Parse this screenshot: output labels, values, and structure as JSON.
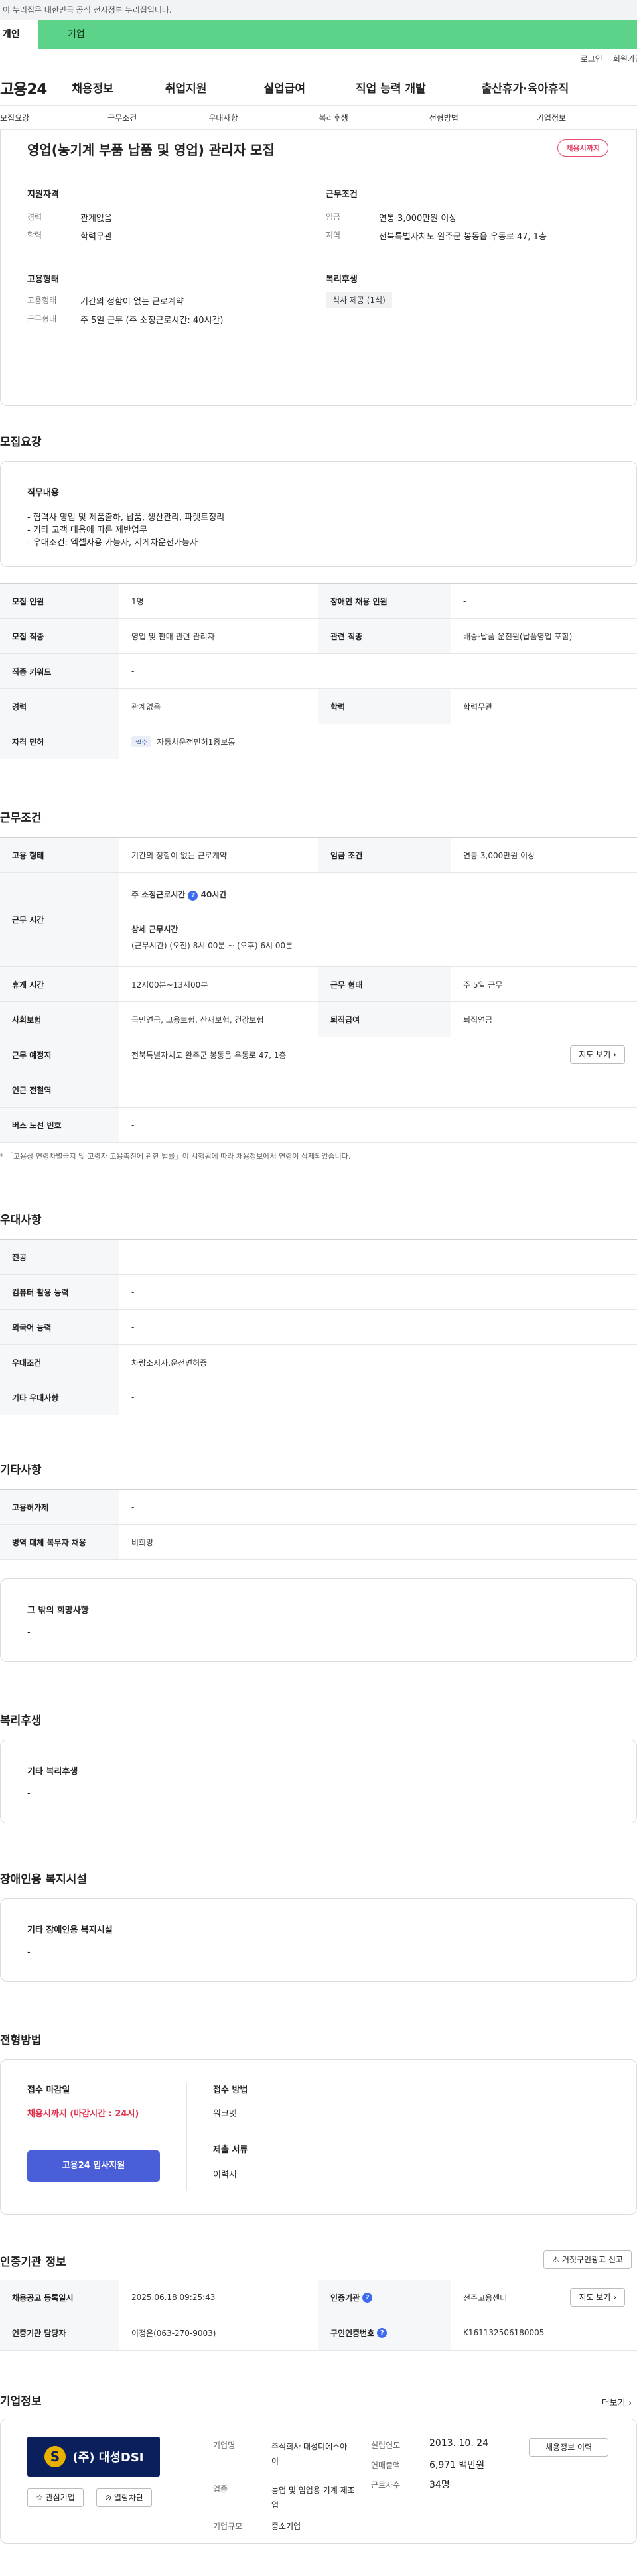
{
  "gov_banner": "이 누리집은 대한민국 공식 전자정부 누리집입니다.",
  "top_tabs": [
    "개인",
    "기업"
  ],
  "util": [
    "로그인",
    "회원가입"
  ],
  "logo": "고용24",
  "gnb": [
    "채용정보",
    "취업지원",
    "실업급여",
    "직업 능력 개발",
    "출산휴가·육아휴직"
  ],
  "subnav": [
    "모집요강",
    "근무조건",
    "우대사항",
    "복리후생",
    "전형방법",
    "기업정보"
  ],
  "job": {
    "title": "영업(농기계 부품 납품 및 영업) 관리자 모집",
    "status": "채용시까지",
    "req_head": "지원자격",
    "career_l": "경력",
    "career_v": "관계없음",
    "edu_l": "학력",
    "edu_v": "학력무관",
    "emp_head": "고용형태",
    "emptype_l": "고용형태",
    "emptype_v": "기간의 정함이 없는 근로계약",
    "worktype_l": "근무형태",
    "worktype_v": "주 5일 근무 (주 소정근로시간: 40시간)",
    "cond_head": "근무조건",
    "wage_l": "임금",
    "wage_v": "연봉 3,000만원 이상",
    "area_l": "지역",
    "area_v": "전북특별자치도 완주군 봉동읍 우동로 47, 1층",
    "welfare_head": "복리후생",
    "welfare_v": "식사 제공 (1식)"
  },
  "recruit": {
    "title": "모집요강",
    "duty_head": "직무내용",
    "duty_lines": [
      "- 협력사 영업 및 제품출하, 납품, 생산관리, 파렛트정리",
      "- 기타 고객 대응에 따른 제반업무",
      "- 우대조건: 엑셀사용 가능자, 지게차운전가능자"
    ],
    "r1_l1": "모집 인원",
    "r1_v1": "1명",
    "r1_l2": "장애인 채용 인원",
    "r1_v2": "-",
    "r2_l1": "모집 직종",
    "r2_v1": "영업 및 판매 관련 관리자",
    "r2_l2": "관련 직종",
    "r2_v2": "배송·납품 운전원(납품영업 포함)",
    "r3_l": "직종 키워드",
    "r3_v": "-",
    "r4_l1": "경력",
    "r4_v1": "관계없음",
    "r4_l2": "학력",
    "r4_v2": "학력무관",
    "r5_l": "자격 면허",
    "r5_tag": "필수",
    "r5_v": "자동차운전면허1종보통"
  },
  "work": {
    "title": "근무조건",
    "w1_l1": "고용 형태",
    "w1_v1": "기간의 정함이 없는 근로계약",
    "w1_l2": "임금 조건",
    "w1_v2": "연봉 3,000만원 이상",
    "w2_l": "근무 시간",
    "w2_a": "주 소정근로시간",
    "w2_a_val": "40시간",
    "w2_b": "상세 근무시간",
    "w2_c": "(근무시간) (오전) 8시 00분 ~ (오후) 6시 00분",
    "w3_l1": "휴게 시간",
    "w3_v1": "12시00분~13시00분",
    "w3_l2": "근무 형태",
    "w3_v2": "주 5일 근무",
    "w4_l1": "사회보험",
    "w4_v1": "국민연금, 고용보험, 산재보험, 건강보험",
    "w4_l2": "퇴직급여",
    "w4_v2": "퇴직연금",
    "w5_l": "근무 예정지",
    "w5_v": "전북특별자치도 완주군 봉동읍 우동로 47, 1층",
    "w5_btn": "지도 보기",
    "w6_l": "인근 전철역",
    "w6_v": "-",
    "w7_l": "버스 노선 번호",
    "w7_v": "-",
    "note": "* 「고용상 연령차별금지 및 고령자 고용촉진에 관한 법률」이 시행됨에 따라 채용정보에서 연령이 삭제되었습니다."
  },
  "prefer": {
    "title": "우대사항",
    "rows": [
      [
        "전공",
        "-"
      ],
      [
        "컴퓨터 활용 능력",
        "-"
      ],
      [
        "외국어 능력",
        "-"
      ],
      [
        "우대조건",
        "차량소지자,운전면허증"
      ],
      [
        "기타 우대사항",
        "-"
      ]
    ]
  },
  "etc": {
    "title": "기타사항",
    "rows": [
      [
        "고용허가제",
        "-"
      ],
      [
        "병역 대체 복무자 채용",
        "비희망"
      ]
    ],
    "card_head": "그 밖의 희망사항",
    "card_v": "-"
  },
  "welfare": {
    "title": "복리후생",
    "head": "기타 복리후생",
    "v": "-"
  },
  "disabled": {
    "title": "장애인용 복지시설",
    "head": "기타 장애인용 복지시설",
    "v": "-"
  },
  "select": {
    "title": "전형방법",
    "deadline_l": "접수 마감일",
    "deadline_v": "채용시까지 (마감시간 : 24시)",
    "apply_btn": "고용24 입사지원",
    "method_l": "접수 방법",
    "method_v": "워크넷",
    "docs_l": "제출 서류",
    "docs_v": "이력서"
  },
  "cert": {
    "title": "인증기관 정보",
    "report_btn": "거짓구인광고 신고",
    "c1_l1": "채용공고 등록일시",
    "c1_v1": "2025.06.18 09:25:43",
    "c1_l2": "인증기관",
    "c1_v2": "전주고용센터",
    "c1_btn": "지도 보기",
    "c2_l1": "인증기관 담당자",
    "c2_v1": "이정은(063-270-9003)",
    "c2_l2": "구인인증번호",
    "c2_v2": "K161132506180005"
  },
  "company": {
    "title": "기업정보",
    "more": "더보기",
    "logo_text": "(주) 대성DSI",
    "fav_btn": "관심기업",
    "block_btn": "열람차단",
    "name_l": "기업명",
    "name_v": "주식회사 대성디에스아이",
    "ind_l": "업종",
    "ind_v": "농업 및 임업용 기계 제조업",
    "size_l": "기업규모",
    "size_v": "중소기업",
    "est_l": "설립연도",
    "est_v": "2013. 10. 24",
    "sales_l": "연매출액",
    "sales_v": "6,971 백만원",
    "emp_l": "근로자수",
    "emp_v": "34명",
    "hist_btn": "채용정보 이력"
  }
}
